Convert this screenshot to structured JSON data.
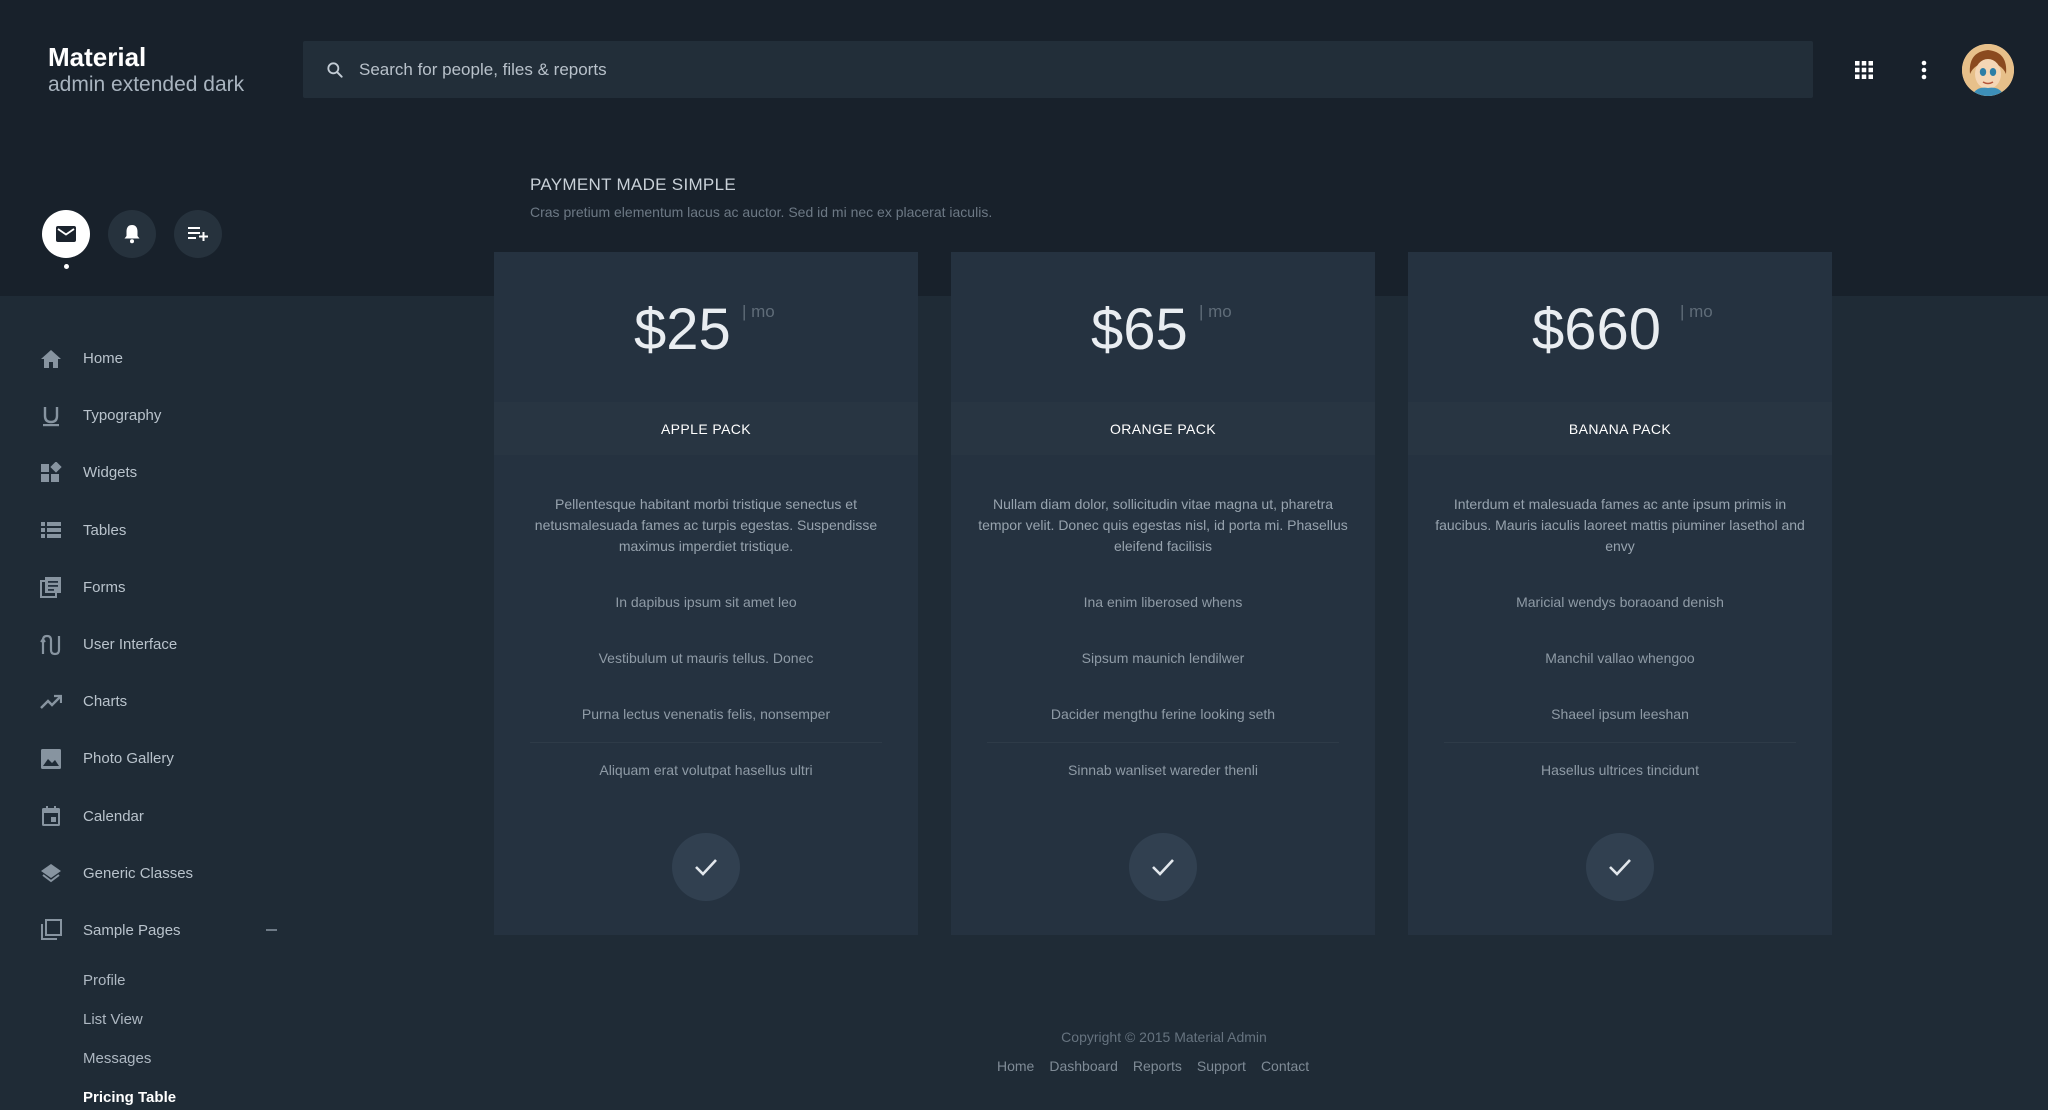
{
  "brand": {
    "title": "Material",
    "subtitle": "admin extended dark"
  },
  "search": {
    "placeholder": "Search for people, files & reports"
  },
  "header": {
    "icons": [
      "apps-grid-icon",
      "more-vert-icon",
      "user-avatar"
    ]
  },
  "profile_actions": [
    "mail-icon",
    "bell-icon",
    "playlist-add-icon"
  ],
  "sidebar": {
    "items": [
      {
        "label": "Home",
        "icon": "home-icon"
      },
      {
        "label": "Typography",
        "icon": "format-underline-icon"
      },
      {
        "label": "Widgets",
        "icon": "widgets-icon"
      },
      {
        "label": "Tables",
        "icon": "list-table-icon"
      },
      {
        "label": "Forms",
        "icon": "forms-icon"
      },
      {
        "label": "User Interface",
        "icon": "user-interface-icon"
      },
      {
        "label": "Charts",
        "icon": "trending-up-icon"
      },
      {
        "label": "Photo Gallery",
        "icon": "image-icon"
      },
      {
        "label": "Calendar",
        "icon": "calendar-icon"
      },
      {
        "label": "Generic Classes",
        "icon": "layers-icon"
      },
      {
        "label": "Sample Pages",
        "icon": "pages-icon"
      }
    ],
    "subitems": [
      "Profile",
      "List View",
      "Messages",
      "Pricing Table"
    ],
    "active_subitem": "Pricing Table"
  },
  "pricing": {
    "title": "PAYMENT MADE SIMPLE",
    "subtitle": "Cras pretium elementum lacus ac auctor. Sed id mi nec ex placerat iaculis.",
    "per_label": "| mo",
    "plans": [
      {
        "price": "$25",
        "name": "APPLE PACK",
        "description": "Pellentesque habitant morbi tristique senectus et netusmalesuada fames ac turpis egestas. Suspendisse maximus imperdiet tristique.",
        "features": [
          "In dapibus ipsum sit amet leo",
          "Vestibulum ut mauris tellus. Donec",
          "Purna lectus venenatis felis, nonsemper",
          "Aliquam erat volutpat hasellus ultri"
        ]
      },
      {
        "price": "$65",
        "name": "ORANGE PACK",
        "description": "Nullam diam dolor, sollicitudin vitae magna ut, pharetra tempor velit. Donec quis egestas nisl, id porta mi. Phasellus eleifend facilisis",
        "features": [
          "Ina enim liberosed whens",
          "Sipsum maunich lendilwer",
          "Dacider mengthu ferine looking seth",
          "Sinnab wanliset wareder thenli"
        ]
      },
      {
        "price": "$660",
        "name": "BANANA PACK",
        "description": "Interdum et malesuada fames ac ante ipsum primis in faucibus. Mauris iaculis laoreet mattis piuminer lasethol and envy",
        "features": [
          "Maricial wendys boraoand denish",
          "Manchil vallao whengoo",
          "Shaeel ipsum leeshan",
          "Hasellus ultrices tincidunt"
        ]
      }
    ]
  },
  "footer": {
    "copyright": "Copyright © 2015 Material Admin",
    "links": [
      "Home",
      "Dashboard",
      "Reports",
      "Support",
      "Contact"
    ]
  },
  "colors": {
    "background": "#1f2b36",
    "header_band": "#18212b",
    "card": "#253240",
    "accent": "#ffffff"
  }
}
